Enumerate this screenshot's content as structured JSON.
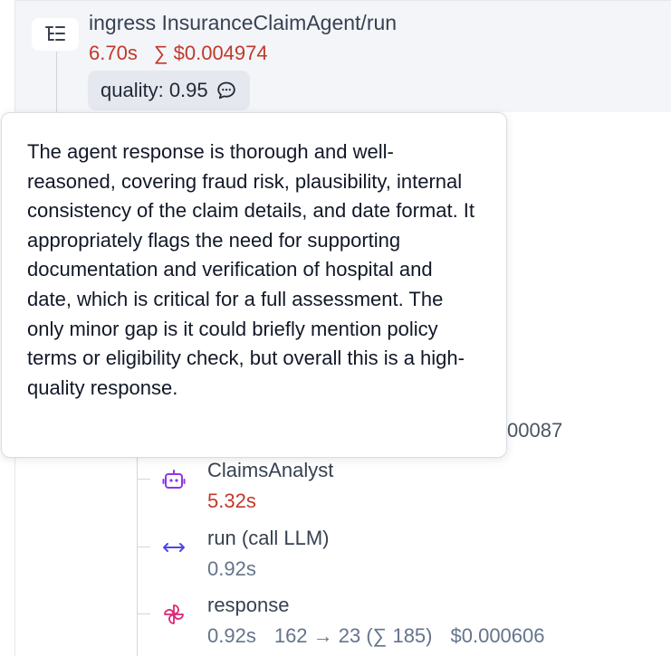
{
  "root": {
    "title": "ingress InsuranceClaimAgent/run",
    "duration": "6.70s",
    "cost": "∑ $0.004974",
    "quality_label": "quality: 0.95"
  },
  "tooltip": {
    "text": "The agent response is thorough and well-reasoned, covering fraud risk, plausibility, internal consistency of the claim details, and date format. It appropriately flags the need for supporting documentation and verification of hospital and date, which is critical for a full assessment. The only minor gap is it could briefly mention policy terms or eligibility check, but overall this is a high-quality response."
  },
  "partial_cost": "00087",
  "children": [
    {
      "name": "ClaimsAnalyst",
      "duration": "5.32s",
      "icon": "robot-icon"
    },
    {
      "name": "run (call LLM)",
      "duration": "0.92s",
      "icon": "arrows-horizontal-icon"
    },
    {
      "name": "response",
      "duration": "0.92s",
      "tokens": "162 → 23 (∑ 185)",
      "cost": "$0.000606",
      "icon": "pinwheel-icon"
    }
  ],
  "colors": {
    "duration_red": "#c0392b",
    "robot_purple": "#9333ea",
    "arrow_blue": "#4f46e5",
    "pinwheel_pink": "#db2777"
  }
}
